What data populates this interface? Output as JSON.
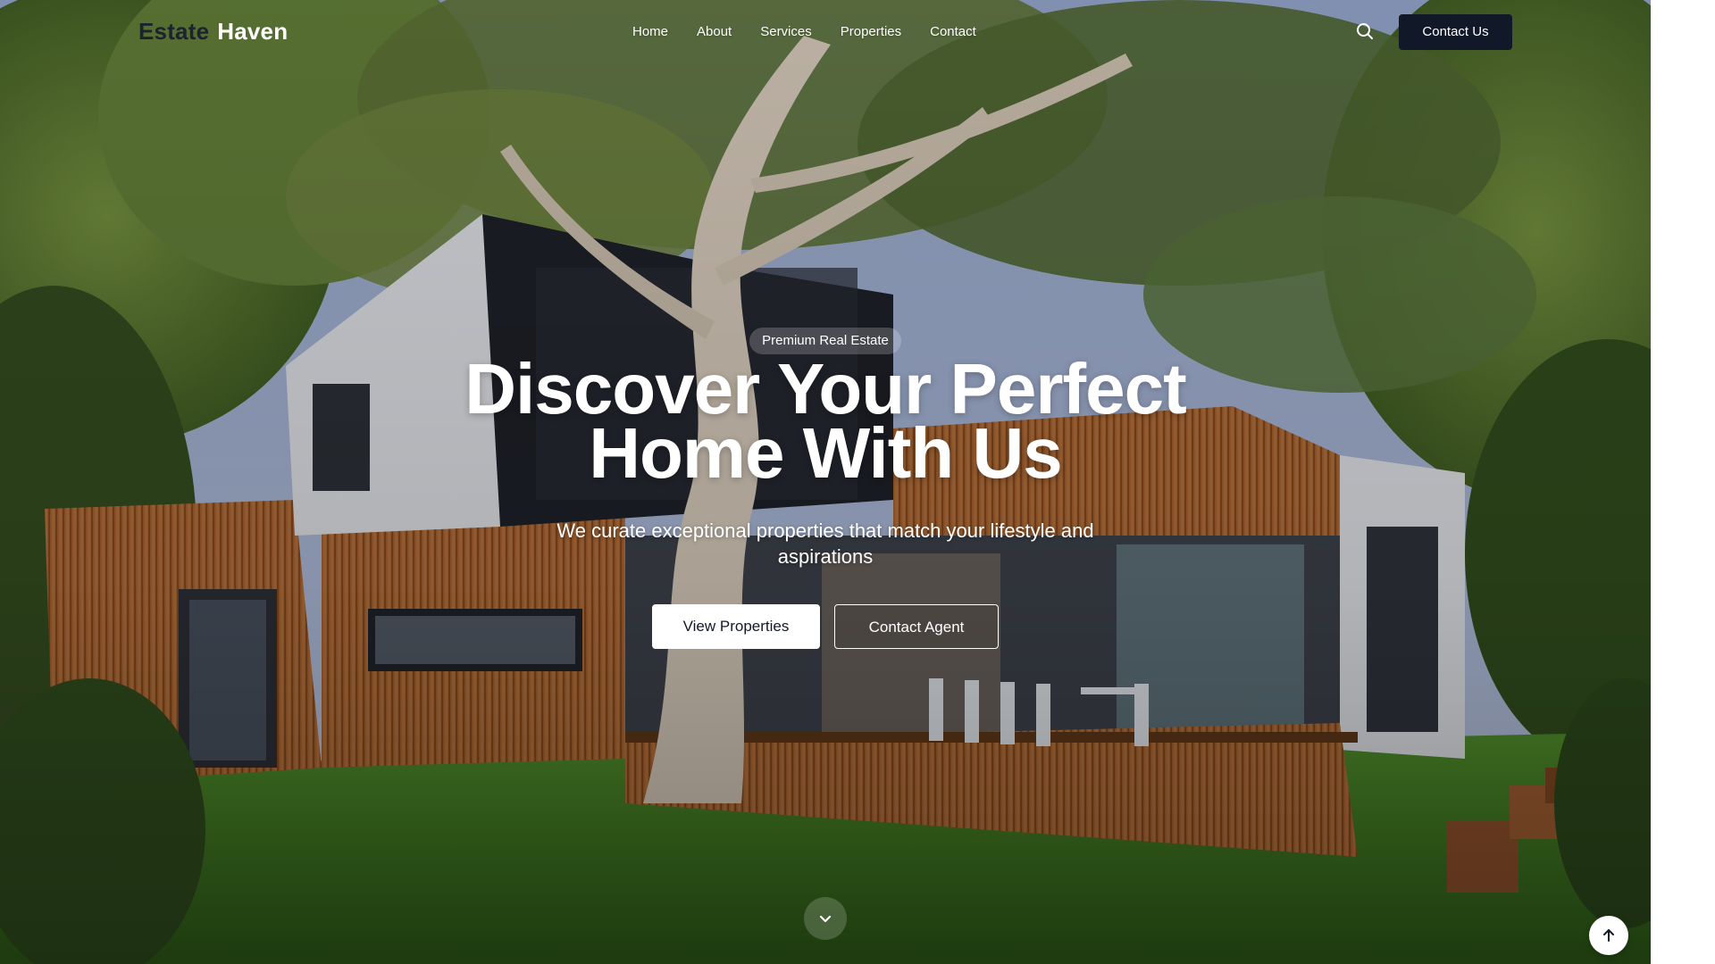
{
  "brand": {
    "name_part1": "Estate",
    "name_part2": "Haven",
    "dark_color": "#1b2230",
    "accent_color": "#ffffff"
  },
  "nav": {
    "links": [
      "Home",
      "About",
      "Services",
      "Properties",
      "Contact"
    ],
    "search_icon": "search-icon",
    "cta_label": "Contact Us",
    "cta_color": "#111827"
  },
  "hero": {
    "badge": "Premium Real Estate",
    "headline_line1": "Discover Your Perfect",
    "headline_line2": "Home With Us",
    "subheadline": "We curate exceptional properties that match your lifestyle and aspirations",
    "primary_button": "View Properties",
    "secondary_button": "Contact Agent",
    "scroll_icon": "chevron-down-icon",
    "back_to_top_icon": "arrow-up-icon",
    "background_image": "modern two-storey house with timber cladding, large gum tree and lawn"
  }
}
